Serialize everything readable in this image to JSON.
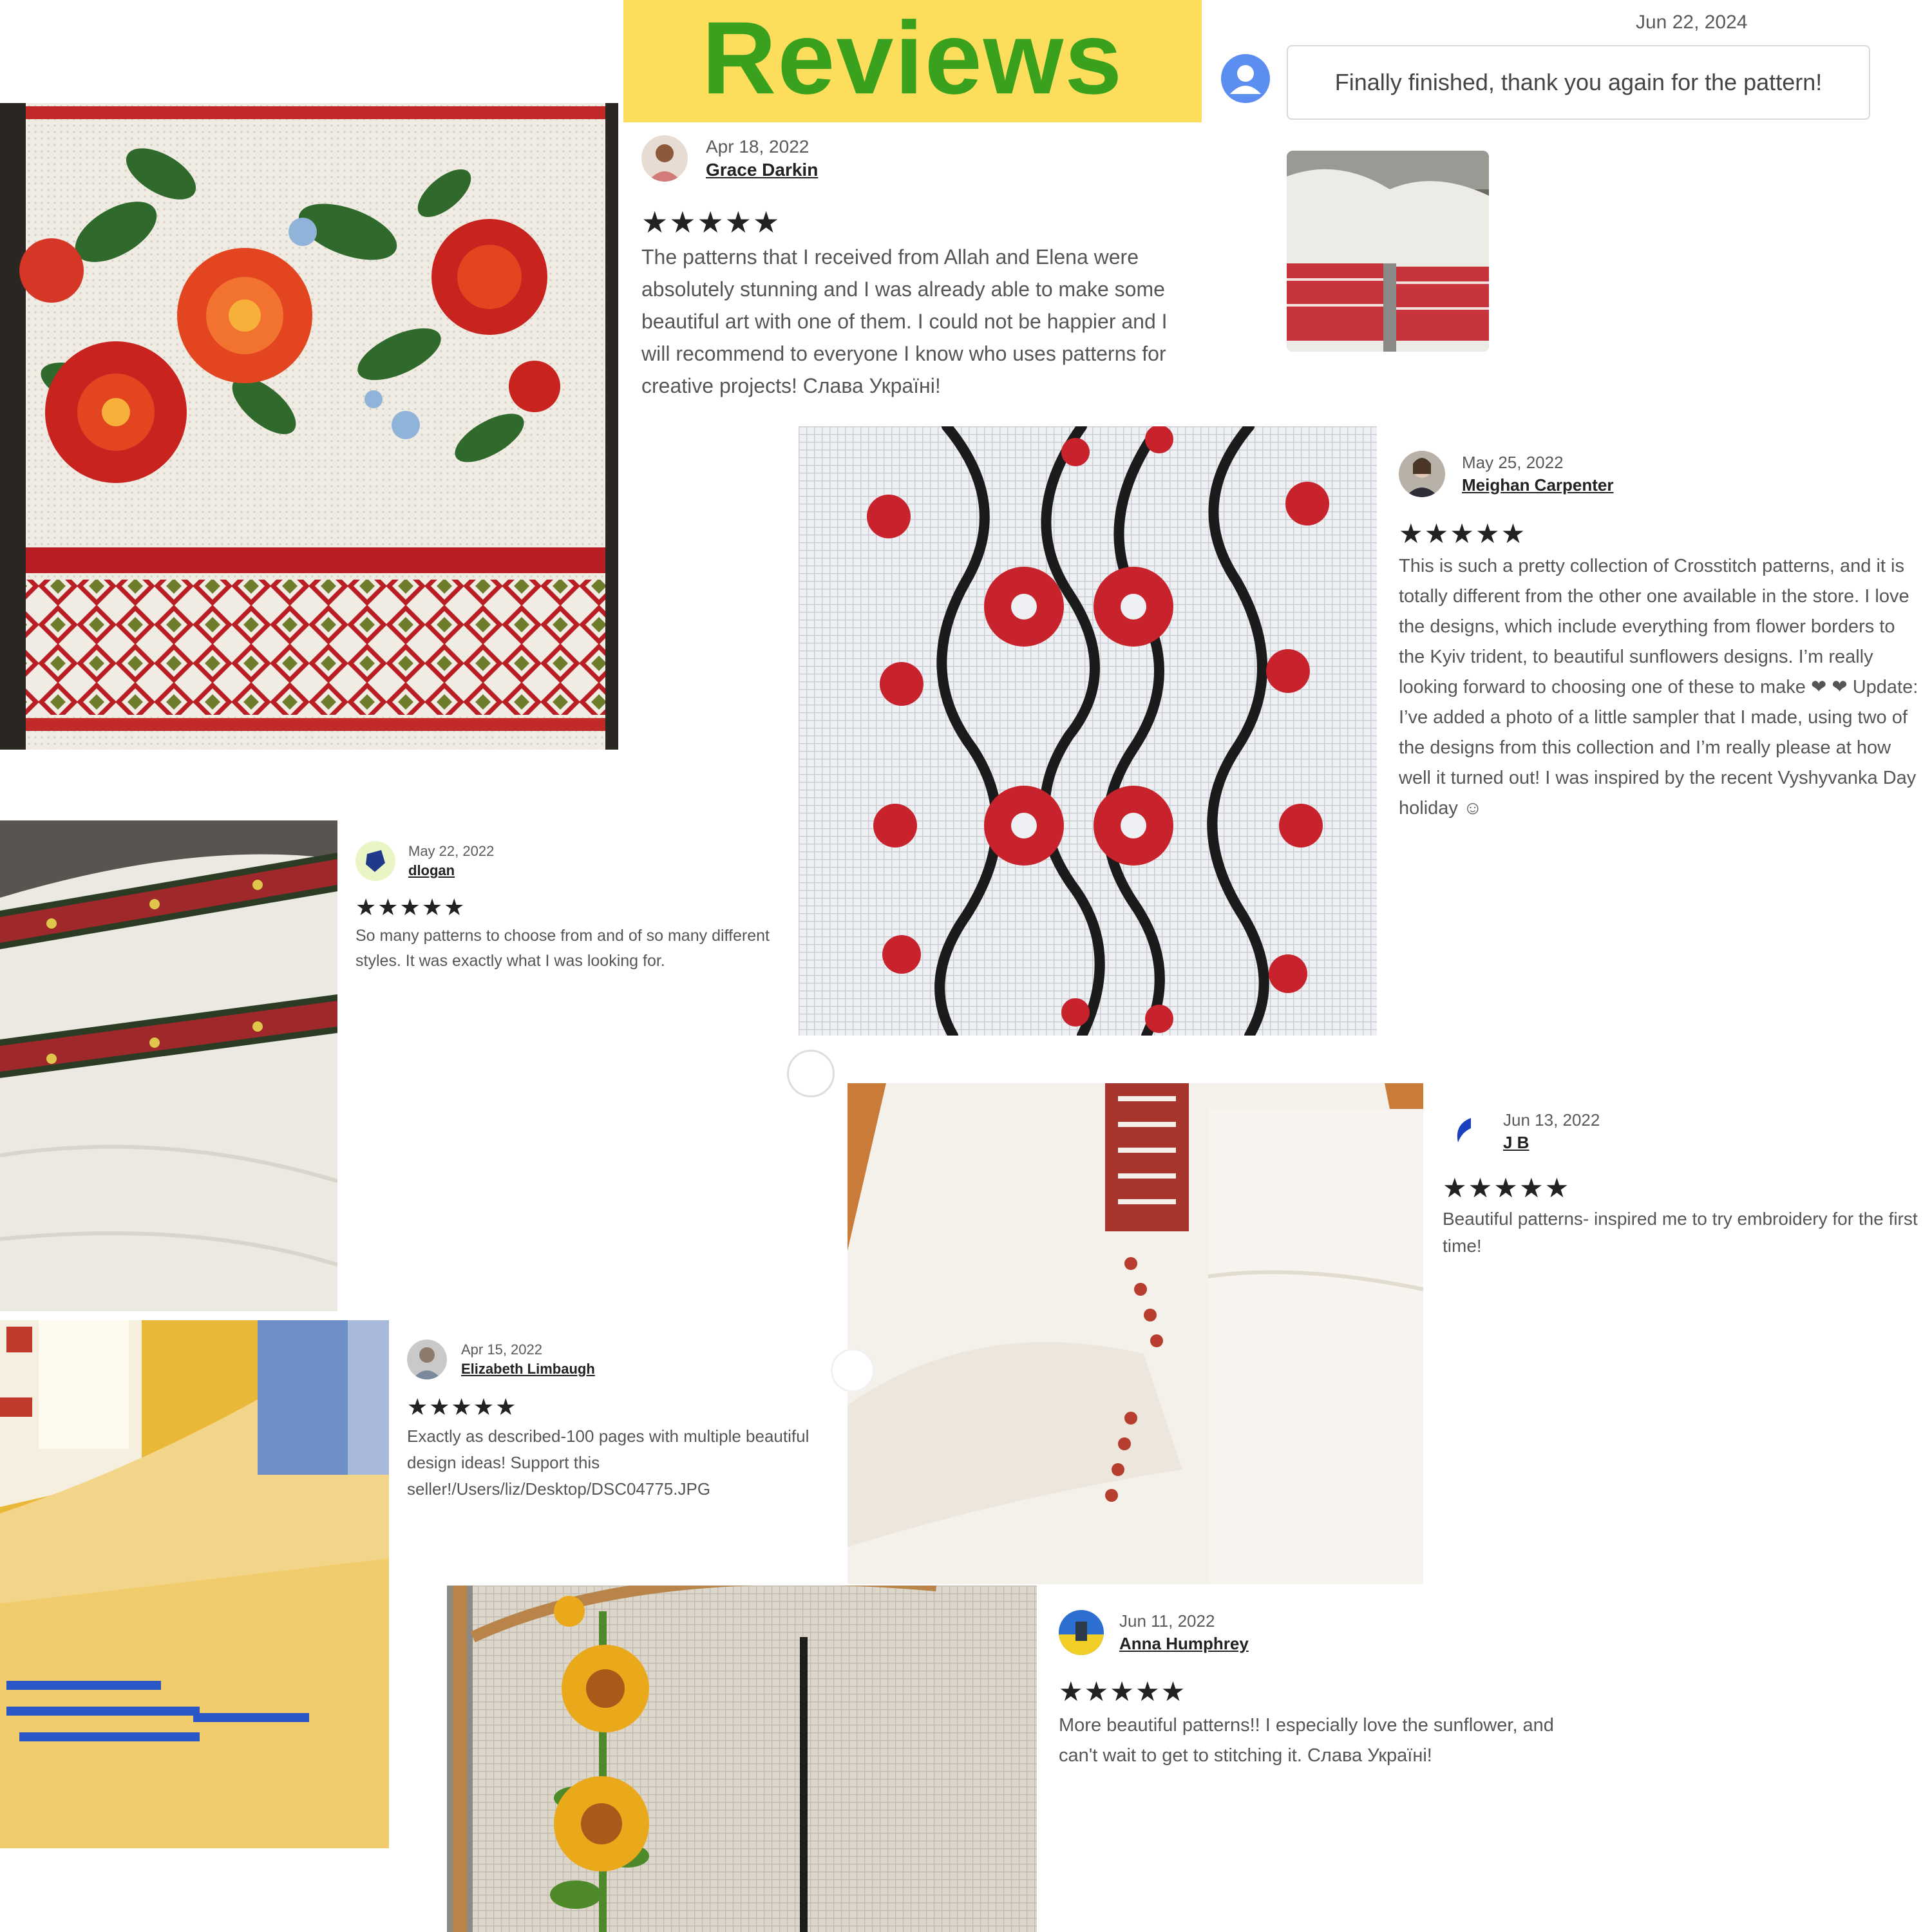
{
  "title": "Reviews",
  "top_review": {
    "date": "Jun 22, 2024",
    "text": "Finally finished, thank you again for the pattern!"
  },
  "reviews": [
    {
      "date": "Apr 18, 2022",
      "name": "Grace Darkin",
      "stars": "★★★★★",
      "rating": 5,
      "text": "The patterns that I received from Allah and Elena were absolutely stunning and I was already able to make some beautiful art with one of them. I could not be happier and I will recommend to everyone I know who uses patterns for creative projects! Слава Україні!"
    },
    {
      "date": "May 25, 2022",
      "name": "Meighan Carpenter",
      "stars": "★★★★★",
      "rating": 5,
      "text": "This is such a pretty collection of Crosstitch patterns, and it is totally different from the other one available in the store. I love the designs, which include everything from flower borders to the Kyiv trident, to beautiful sunflowers designs. I’m really looking forward to choosing one of these to make ❤ ❤ Update: I’ve added a photo of a little sampler that I made, using two of the designs from this collection and I’m really please at how well it turned out! I was inspired by the recent Vyshyvanka Day holiday ☺"
    },
    {
      "date": "May 22, 2022",
      "name": "dlogan",
      "stars": "★★★★★",
      "rating": 5,
      "text": "So many patterns to choose from and of so many different styles. It was exactly what I was looking for."
    },
    {
      "date": "Jun 13, 2022",
      "name": "J B",
      "stars": "★★★★★",
      "rating": 5,
      "text": "Beautiful patterns- inspired me to try embroidery for the first time!"
    },
    {
      "date": "Apr 15, 2022",
      "name": "Elizabeth Limbaugh",
      "stars": "★★★★★",
      "rating": 5,
      "text": "Exactly as described-100 pages with multiple beautiful design ideas! Support this seller!/Users/liz/Desktop/DSC04775.JPG"
    },
    {
      "date": "Jun 11, 2022",
      "name": "Anna Humphrey",
      "stars": "★★★★★",
      "rating": 5,
      "text": "More beautiful patterns!! I especially love the sunflower, and can't wait to get to stitching it. Слава Україні!"
    }
  ],
  "colors": {
    "banner": "#fddd5c",
    "title": "#3aa11e",
    "embroidery_red": "#c8232c",
    "embroidery_black": "#1b1b1b",
    "sunflower": "#e9a91b"
  }
}
